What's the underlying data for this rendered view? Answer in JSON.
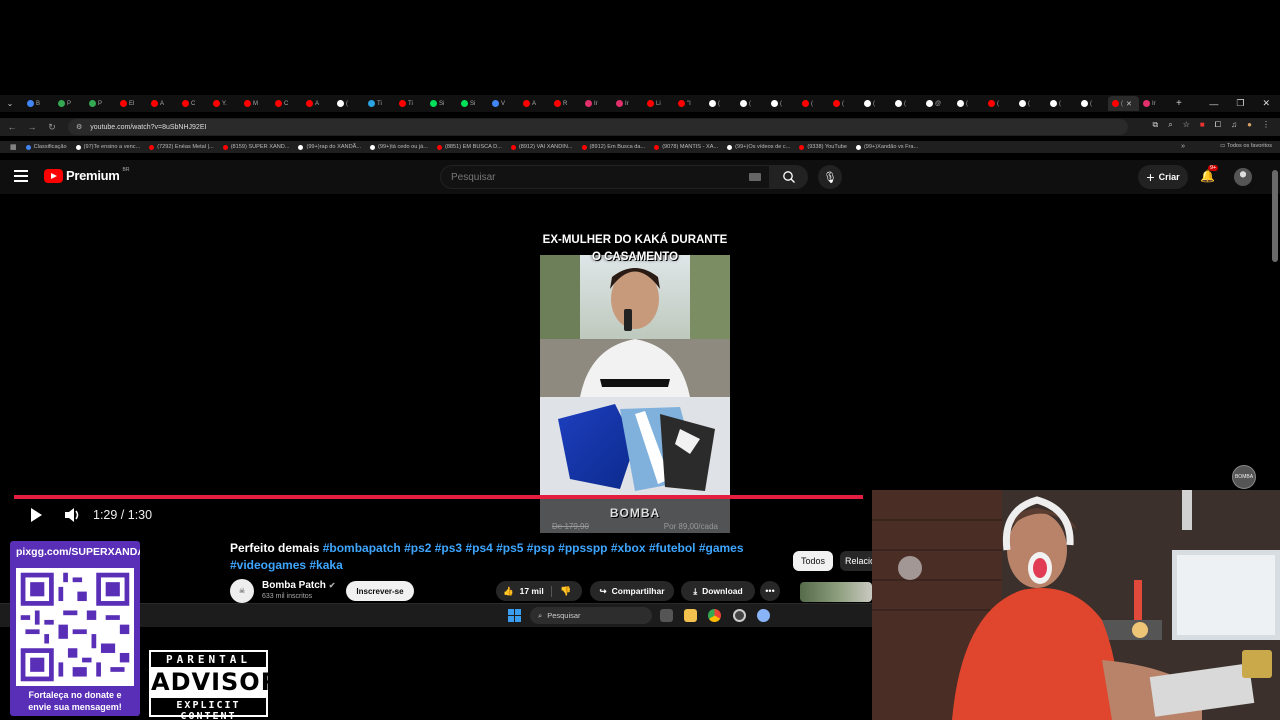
{
  "browser": {
    "tabs": [
      {
        "label": "B",
        "color": "#4285f4"
      },
      {
        "label": "P",
        "color": "#34a853"
      },
      {
        "label": "P",
        "color": "#34a853"
      },
      {
        "label": "El",
        "color": "#ff0000"
      },
      {
        "label": "A",
        "color": "#ff0000"
      },
      {
        "label": "C",
        "color": "#ff0000"
      },
      {
        "label": "Y.",
        "color": "#ff0000"
      },
      {
        "label": "M",
        "color": "#ff0000"
      },
      {
        "label": "C",
        "color": "#ff0000"
      },
      {
        "label": "A",
        "color": "#ff0000"
      },
      {
        "label": "(",
        "color": "#ffffff"
      },
      {
        "label": "Ti",
        "color": "#2aa3e0"
      },
      {
        "label": "Ti",
        "color": "#ff0000"
      },
      {
        "label": "Si",
        "color": "#00e05a"
      },
      {
        "label": "Si",
        "color": "#00e05a"
      },
      {
        "label": "V",
        "color": "#4285f4"
      },
      {
        "label": "A",
        "color": "#ff0000"
      },
      {
        "label": "R",
        "color": "#ff0000"
      },
      {
        "label": "Ir",
        "color": "#e1306c"
      },
      {
        "label": "Ir",
        "color": "#e1306c"
      },
      {
        "label": "Li",
        "color": "#ff0000"
      },
      {
        "label": "\"I",
        "color": "#ff0000"
      },
      {
        "label": "(",
        "color": "#ffffff"
      },
      {
        "label": "(",
        "color": "#ffffff"
      },
      {
        "label": "(",
        "color": "#ffffff"
      },
      {
        "label": "(",
        "color": "#ff0000"
      },
      {
        "label": "(",
        "color": "#ff0000"
      },
      {
        "label": "(",
        "color": "#ffffff"
      },
      {
        "label": "(",
        "color": "#ffffff"
      },
      {
        "label": "@",
        "color": "#ffffff"
      },
      {
        "label": "(",
        "color": "#ffffff"
      },
      {
        "label": "(",
        "color": "#ff0000"
      },
      {
        "label": "(",
        "color": "#ffffff"
      },
      {
        "label": "(",
        "color": "#ffffff"
      },
      {
        "label": "(",
        "color": "#ffffff"
      },
      {
        "label": "(",
        "color": "#ff0000",
        "active": true
      },
      {
        "label": "Ir",
        "color": "#e1306c"
      }
    ],
    "url": "youtube.com/watch?v=8uSbNHJ92EI",
    "bookmarks": [
      {
        "label": "Classificação",
        "color": "#4285f4"
      },
      {
        "label": "(97)Te ensino a venc...",
        "color": "#ffffff"
      },
      {
        "label": "(7292) Enéas Metal |...",
        "color": "#ff0000"
      },
      {
        "label": "(8159) SUPER XAND...",
        "color": "#ff0000"
      },
      {
        "label": "(99+)rap do XANDÃ...",
        "color": "#ffffff"
      },
      {
        "label": "(99+)tá cedo ou já...",
        "color": "#ffffff"
      },
      {
        "label": "(8851) EM BUSCA D...",
        "color": "#ff0000"
      },
      {
        "label": "(8912) VAI XANDIN...",
        "color": "#ff0000"
      },
      {
        "label": "(8912) Em Busca da...",
        "color": "#ff0000"
      },
      {
        "label": "(9078) MANTIS - XA...",
        "color": "#ff0000"
      },
      {
        "label": "(99+)Os vídeos de c...",
        "color": "#ffffff"
      },
      {
        "label": "(9338) YouTube",
        "color": "#ff0000"
      },
      {
        "label": "(99+)Xandão vs Fra...",
        "color": "#ffffff"
      }
    ],
    "bookmarks_all": "Todos os favoritos"
  },
  "youtube": {
    "logo_text": "Premium",
    "logo_country": "BR",
    "search_placeholder": "Pesquisar",
    "create_label": "Criar",
    "notif_badge": "9+",
    "video": {
      "overlay_title_line1": "EX-MULHER DO KAKÁ DURANTE",
      "overlay_title_line2": "O CASAMENTO",
      "overlay_bottom": "BOMBA",
      "price_left": "De 179,90",
      "price_right": "Por 89,00/cada",
      "watermark": "BOMBA",
      "progress_fraction": 0.99,
      "time": "1:29 / 1:30"
    },
    "title_plain": "Perfeito demais",
    "title_tags": "#bombapatch #ps2 #ps3 #ps4 #ps5 #psp #ppsspp #xbox #futebol #games #videogames #kaka",
    "channel": {
      "name": "Bomba Patch",
      "subscribers": "633 mil inscritos",
      "subscribe_label": "Inscrever-se"
    },
    "likes": "17 mil",
    "share_label": "Compartilhar",
    "download_label": "Download",
    "chips": [
      "Todos",
      "Relacionados"
    ]
  },
  "taskbar": {
    "search_placeholder": "Pesquisar"
  },
  "overlay": {
    "qr_url": "pixgg.com/SUPERXANDAO",
    "qr_caption_line1": "Fortaleça no donate e",
    "qr_caption_line2": "envie sua mensagem!",
    "qr_bg": "#5a2fb7",
    "pa_top": "PARENTAL",
    "pa_mid": "ADVISORY",
    "pa_bottom": "EXPLICIT CONTENT"
  }
}
